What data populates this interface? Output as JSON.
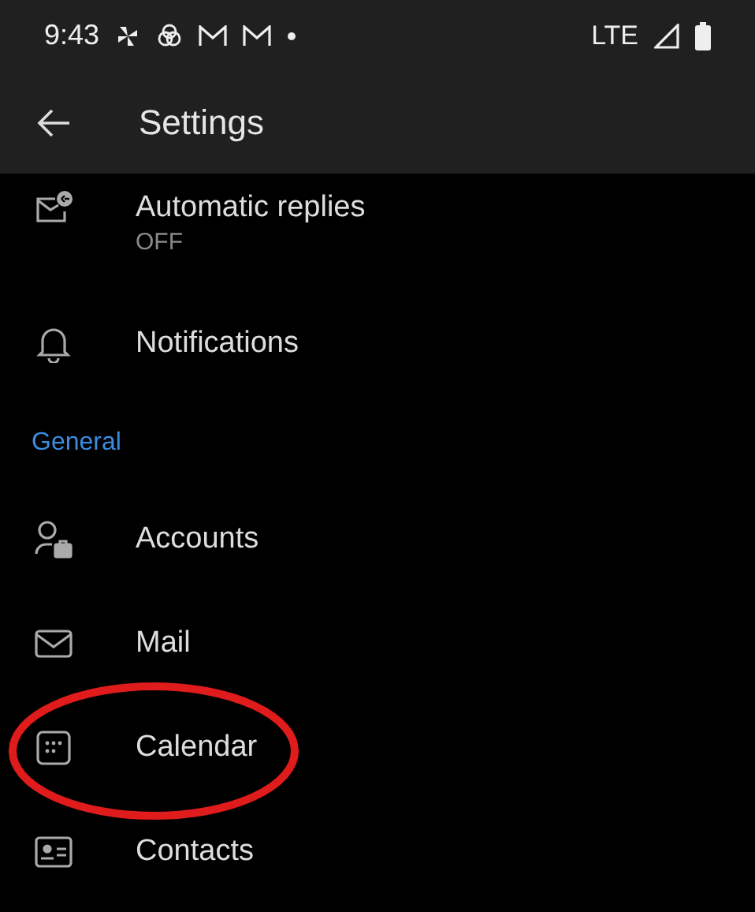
{
  "status_bar": {
    "time": "9:43",
    "network": "LTE"
  },
  "toolbar": {
    "title": "Settings"
  },
  "items": [
    {
      "kind": "item",
      "label": "Automatic replies",
      "value": "OFF"
    },
    {
      "kind": "item",
      "label": "Notifications"
    },
    {
      "kind": "header",
      "label": "General"
    },
    {
      "kind": "item",
      "label": "Accounts"
    },
    {
      "kind": "item",
      "label": "Mail"
    },
    {
      "kind": "item",
      "label": "Calendar",
      "highlighted": true
    },
    {
      "kind": "item",
      "label": "Contacts"
    }
  ]
}
